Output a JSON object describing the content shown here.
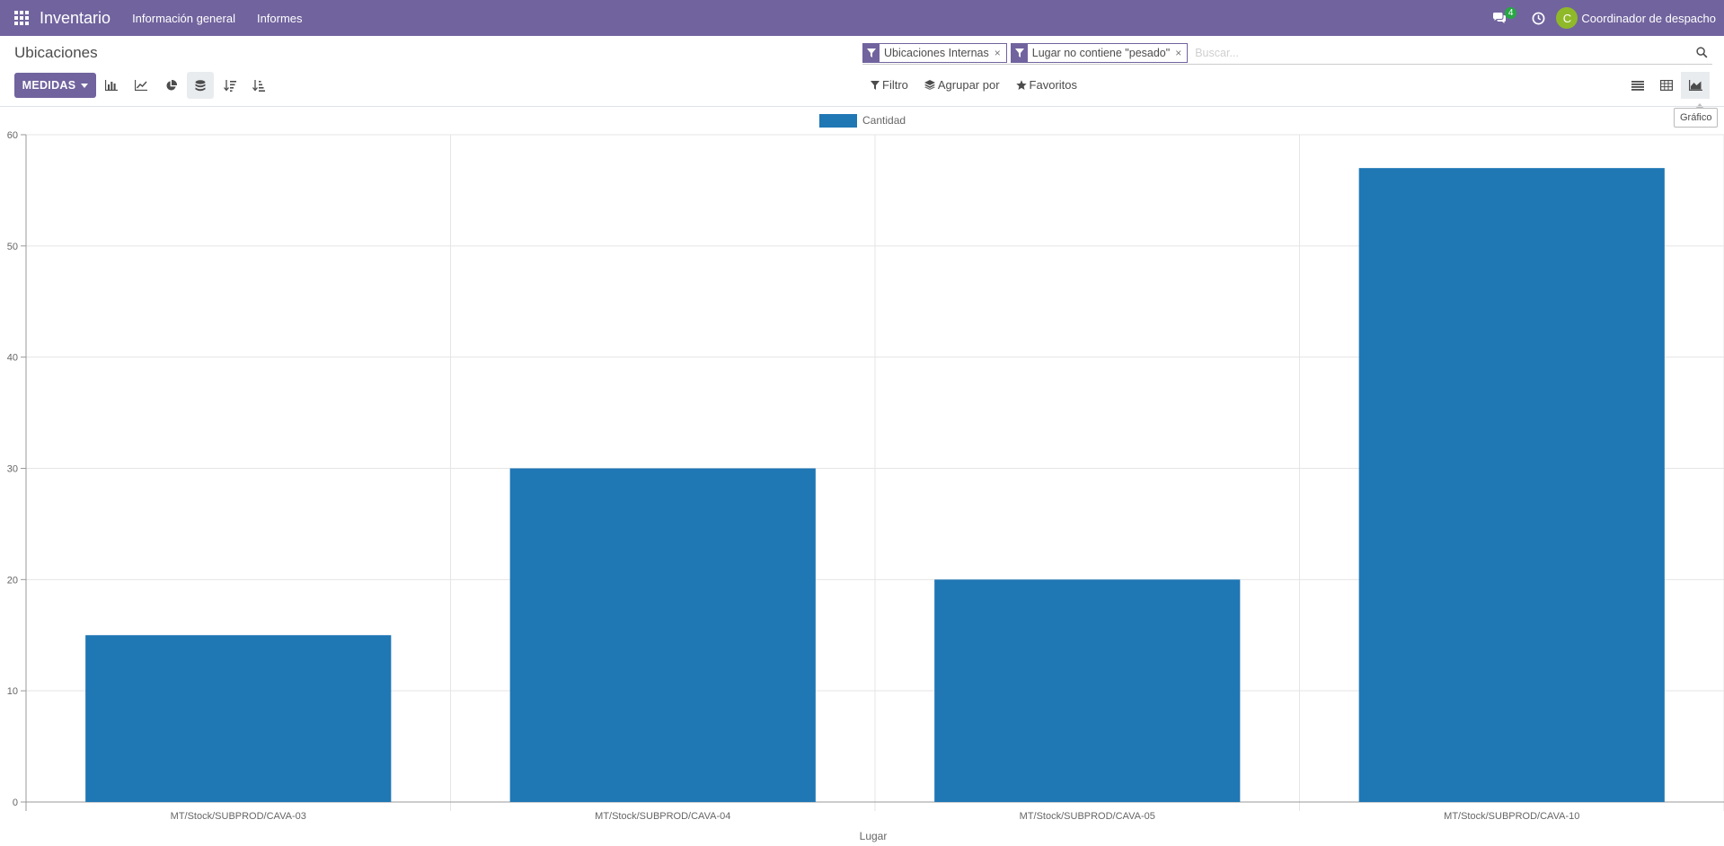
{
  "navbar": {
    "app_name": "Inventario",
    "menus": [
      "Información general",
      "Informes"
    ],
    "chat_count": "4",
    "user_initial": "C",
    "user_name": "Coordinador de despacho"
  },
  "control_panel": {
    "breadcrumb": "Ubicaciones",
    "facets": [
      {
        "label": "Ubicaciones Internas",
        "remove": "×"
      },
      {
        "label": "Lugar no contiene \"pesado\"",
        "remove": "×"
      }
    ],
    "search_placeholder": "Buscar...",
    "measures_label": "MEDIDAS",
    "filter_label": "Filtro",
    "groupby_label": "Agrupar por",
    "favorites_label": "Favoritos",
    "tooltip": "Gráfico"
  },
  "colors": {
    "navbar": "#71639e",
    "bar": "#1f77b4"
  },
  "chart_data": {
    "type": "bar",
    "categories": [
      "MT/Stock/SUBPROD/CAVA-03",
      "MT/Stock/SUBPROD/CAVA-04",
      "MT/Stock/SUBPROD/CAVA-05",
      "MT/Stock/SUBPROD/CAVA-10"
    ],
    "series": [
      {
        "name": "Cantidad",
        "values": [
          15,
          30,
          20,
          57
        ]
      }
    ],
    "xlabel": "Lugar",
    "ylabel": "",
    "ylim": [
      0,
      60
    ],
    "yticks": [
      0,
      10,
      20,
      30,
      40,
      50,
      60
    ],
    "grid": true,
    "legend_position": "top-center"
  }
}
